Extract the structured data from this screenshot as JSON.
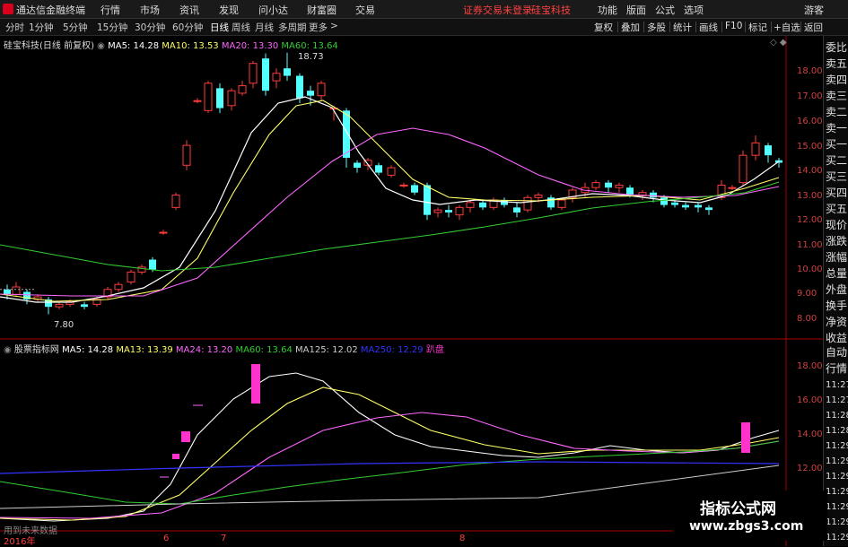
{
  "topbar": {
    "app_title": "通达信金融终端",
    "menu": [
      "行情",
      "市场",
      "资讯",
      "发现",
      "问小达",
      "财富圈",
      "交易"
    ],
    "login_notice": "证券交易未登录",
    "stock_name": "硅宝科技",
    "right_menu": [
      "功能",
      "版面",
      "公式",
      "选项"
    ],
    "guest": "游客"
  },
  "periods": [
    "分时",
    "1分钟",
    "5分钟",
    "15分钟",
    "30分钟",
    "60分钟",
    "日线",
    "周线",
    "月线",
    "多周期",
    "更多"
  ],
  "toolbar": [
    "复权",
    "叠加",
    "多股",
    "统计",
    "画线",
    "F10",
    "标记",
    "+自选",
    "返回"
  ],
  "main_legend": {
    "title": "硅宝科技(日线 前复权)",
    "ma5": "MA5: 14.28",
    "ma10": "MA10: 13.53",
    "ma20": "MA20: 13.30",
    "ma60": "MA60: 13.64"
  },
  "annotations": {
    "high": "18.73",
    "low": "7.80"
  },
  "main_axis": [
    "18.00",
    "17.00",
    "16.00",
    "15.00",
    "14.00",
    "13.00",
    "12.00",
    "11.00",
    "10.00",
    "9.00",
    "8.00"
  ],
  "sub_legend": {
    "title": "股票指标网",
    "ma5": "MA5: 14.28",
    "ma13": "MA13: 13.39",
    "ma24": "MA24: 13.20",
    "ma60": "MA60: 13.64",
    "ma125": "MA125: 12.02",
    "ma250": "MA250: 12.29",
    "tail": "趴盘"
  },
  "sub_axis": [
    "18.00",
    "16.00",
    "14.00",
    "12.00"
  ],
  "date_axis": {
    "year": "2016年",
    "marks": [
      "6",
      "7",
      "8"
    ]
  },
  "sub_bottom_text": "用到未来数据",
  "sidebar_top": [
    "委比",
    "卖五",
    "卖四",
    "卖三",
    "卖二",
    "卖一",
    "买一",
    "买二",
    "买三",
    "买四",
    "买五",
    "现价",
    "涨跌",
    "涨幅",
    "总量",
    "外盘",
    "换手",
    "净资",
    "收益"
  ],
  "sidebar_bottom": [
    "自动",
    "行情"
  ],
  "times": [
    "11:27",
    "11:27",
    "11:28",
    "11:28",
    "11:29",
    "11:29",
    "11:29",
    "11:29",
    "11:29",
    "11:29",
    "11:29"
  ],
  "watermark": {
    "line1": "指标公式网",
    "line2": "www.zbgs3.com"
  },
  "colors": {
    "up": "#ff3b3b",
    "down": "#54ffff",
    "ma5": "#ffffff",
    "ma10": "#ffff66",
    "ma20": "#ff66ff",
    "ma60": "#33cc33",
    "ma250": "#3333ff",
    "bar": "#ff33cc"
  }
}
